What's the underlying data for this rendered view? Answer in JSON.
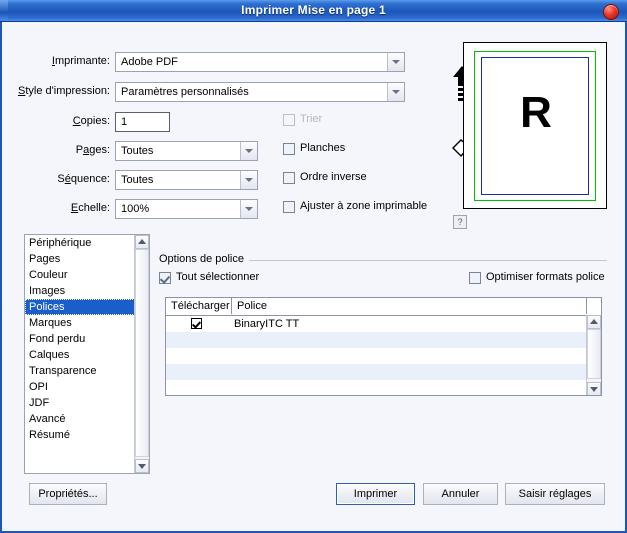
{
  "window": {
    "title": "Imprimer Mise en page 1",
    "close_icon": "close-icon"
  },
  "form": {
    "printer": {
      "label_pre": "I",
      "label_mn": "m",
      "label_post": "primante:",
      "label_full": "Imprimante:",
      "value": "Adobe PDF"
    },
    "style": {
      "label_full": "Style d'impression:",
      "value": "Paramètres personnalisés"
    },
    "copies": {
      "label_full": "Copies:",
      "value": "1"
    },
    "pages": {
      "label_full": "Pages:",
      "value": "Toutes"
    },
    "sequence": {
      "label_full": "Séquence:",
      "value": "Toutes"
    },
    "scale": {
      "label_full": "Echelle:",
      "value": "100%"
    },
    "checkboxes": [
      {
        "label": "Trier",
        "checked": false,
        "disabled": true
      },
      {
        "label": "Planches",
        "checked": false,
        "disabled": false
      },
      {
        "label": "Ordre inverse",
        "checked": false,
        "disabled": false
      },
      {
        "label": "Ajuster à zone imprimable",
        "checked": false,
        "disabled": false
      }
    ]
  },
  "preview": {
    "letter": "R",
    "help_label": "?",
    "orientation_icon": "arrow-up-icon",
    "rotate_icon": "page-rotate-icon",
    "border_green": "#00c000",
    "border_blue": "#1a2f9e"
  },
  "sidebar": {
    "items": [
      {
        "label": "Périphérique",
        "selected": false
      },
      {
        "label": "Pages",
        "selected": false
      },
      {
        "label": "Couleur",
        "selected": false
      },
      {
        "label": "Images",
        "selected": false
      },
      {
        "label": "Polices",
        "selected": true
      },
      {
        "label": "Marques",
        "selected": false
      },
      {
        "label": "Fond perdu",
        "selected": false
      },
      {
        "label": "Calques",
        "selected": false
      },
      {
        "label": "Transparence",
        "selected": false
      },
      {
        "label": "OPI",
        "selected": false
      },
      {
        "label": "JDF",
        "selected": false
      },
      {
        "label": "Avancé",
        "selected": false
      },
      {
        "label": "Résumé",
        "selected": false
      }
    ]
  },
  "font_options": {
    "group_title": "Options de police",
    "select_all": {
      "label": "Tout sélectionner",
      "checked": true
    },
    "optimize": {
      "label": "Optimiser formats police",
      "checked": false
    },
    "table": {
      "columns": [
        "Télécharger",
        "Police"
      ],
      "rows": [
        {
          "download": true,
          "name": "BinaryITC TT"
        },
        {
          "download": null,
          "name": ""
        },
        {
          "download": null,
          "name": ""
        },
        {
          "download": null,
          "name": ""
        },
        {
          "download": null,
          "name": ""
        }
      ]
    }
  },
  "footer": {
    "properties": "Propriétés...",
    "print": "Imprimer",
    "cancel": "Annuler",
    "save_settings": "Saisir réglages"
  },
  "colors": {
    "titlebar": "#1b56b8",
    "selection": "#1b5ec9",
    "dialog_bg": "#f4f6fb",
    "close": "#e8352a"
  }
}
